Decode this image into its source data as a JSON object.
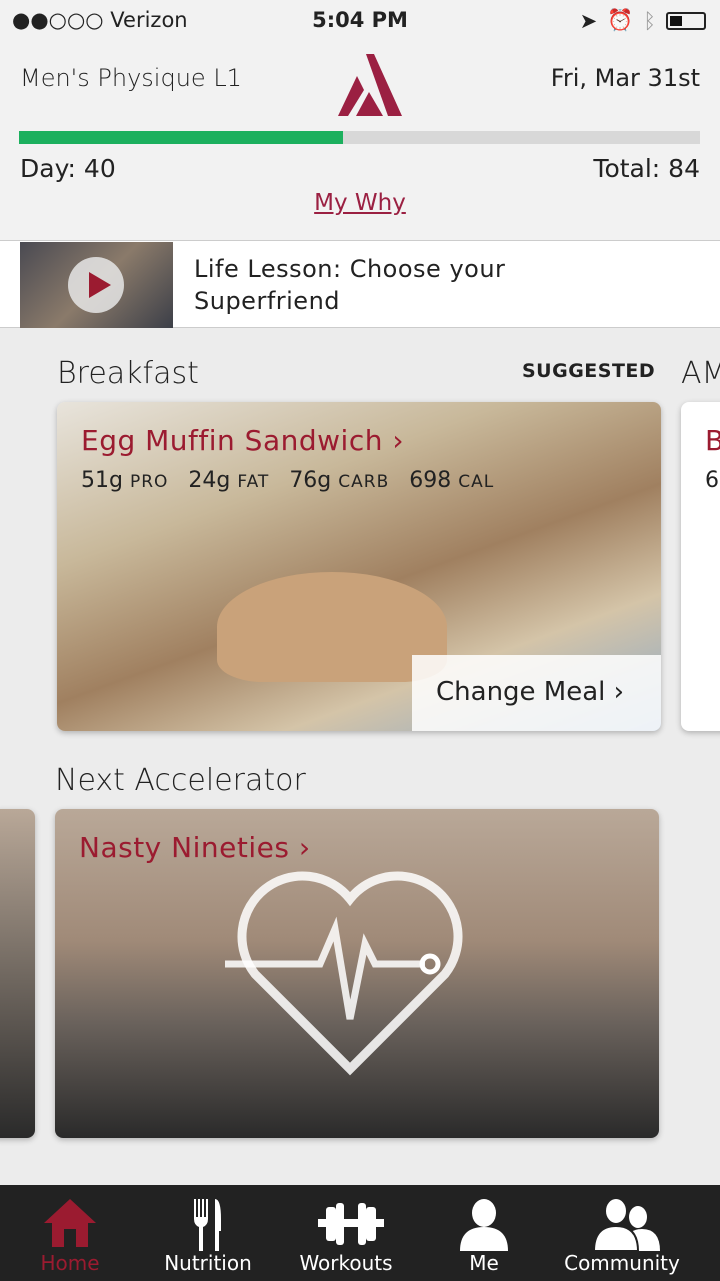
{
  "status_bar": {
    "carrier": "●●○○○ Verizon",
    "time": "5:04 PM"
  },
  "header": {
    "program": "Men's Physique L1",
    "date": "Fri, Mar 31st",
    "day_label": "Day: 40",
    "total_label": "Total: 84",
    "progress": 0.476,
    "my_why": "My Why",
    "accent": "#9b1b30",
    "progress_color": "#1cb05e"
  },
  "lesson": {
    "title": "Life Lesson: Choose your Superfriend"
  },
  "meals": {
    "section": "Breakfast",
    "badge": "SUGGESTED",
    "next_section": "AM",
    "card": {
      "name": "Egg Muffin Sandwich",
      "macros": [
        {
          "v": "51g",
          "u": "PRO"
        },
        {
          "v": "24g",
          "u": "FAT"
        },
        {
          "v": "76g",
          "u": "CARB"
        },
        {
          "v": "698",
          "u": "CAL"
        }
      ],
      "change": "Change Meal"
    },
    "peek": {
      "name": "B",
      "value": "6"
    }
  },
  "accelerator": {
    "section": "Next Accelerator",
    "name": "Nasty Nineties"
  },
  "tabs": [
    {
      "label": "Home",
      "icon": "home-icon"
    },
    {
      "label": "Nutrition",
      "icon": "fork-knife-icon"
    },
    {
      "label": "Workouts",
      "icon": "dumbbell-icon"
    },
    {
      "label": "Me",
      "icon": "person-icon"
    },
    {
      "label": "Community",
      "icon": "group-icon"
    }
  ]
}
